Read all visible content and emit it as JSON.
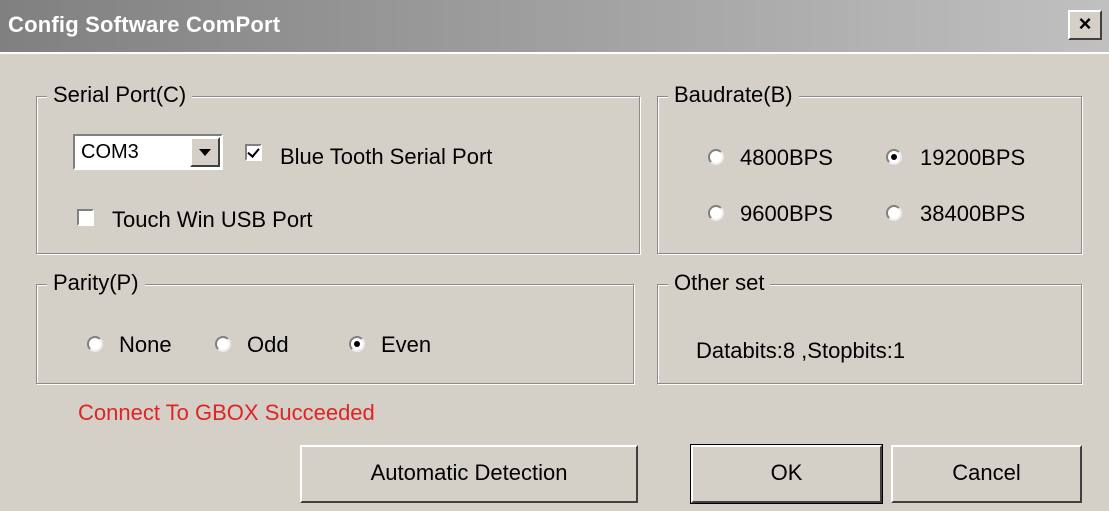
{
  "window": {
    "title": "Config Software ComPort",
    "close_label": "×"
  },
  "serial_port": {
    "legend": "Serial Port(C)",
    "com_value": "COM3",
    "bluetooth_label": "Blue Tooth Serial Port",
    "bluetooth_checked": true,
    "usb_label": "Touch Win USB Port",
    "usb_checked": false
  },
  "baudrate": {
    "legend": "Baudrate(B)",
    "options": [
      "4800BPS",
      "19200BPS",
      "9600BPS",
      "38400BPS"
    ],
    "selected": "19200BPS"
  },
  "parity": {
    "legend": "Parity(P)",
    "options": [
      "None",
      "Odd",
      "Even"
    ],
    "selected": "Even"
  },
  "other_set": {
    "legend": "Other set",
    "text": "Databits:8 ,Stopbits:1"
  },
  "status": {
    "text": "Connect To GBOX Succeeded",
    "color": "#e02424"
  },
  "buttons": {
    "auto_detect": "Automatic Detection",
    "ok": "OK",
    "cancel": "Cancel"
  }
}
